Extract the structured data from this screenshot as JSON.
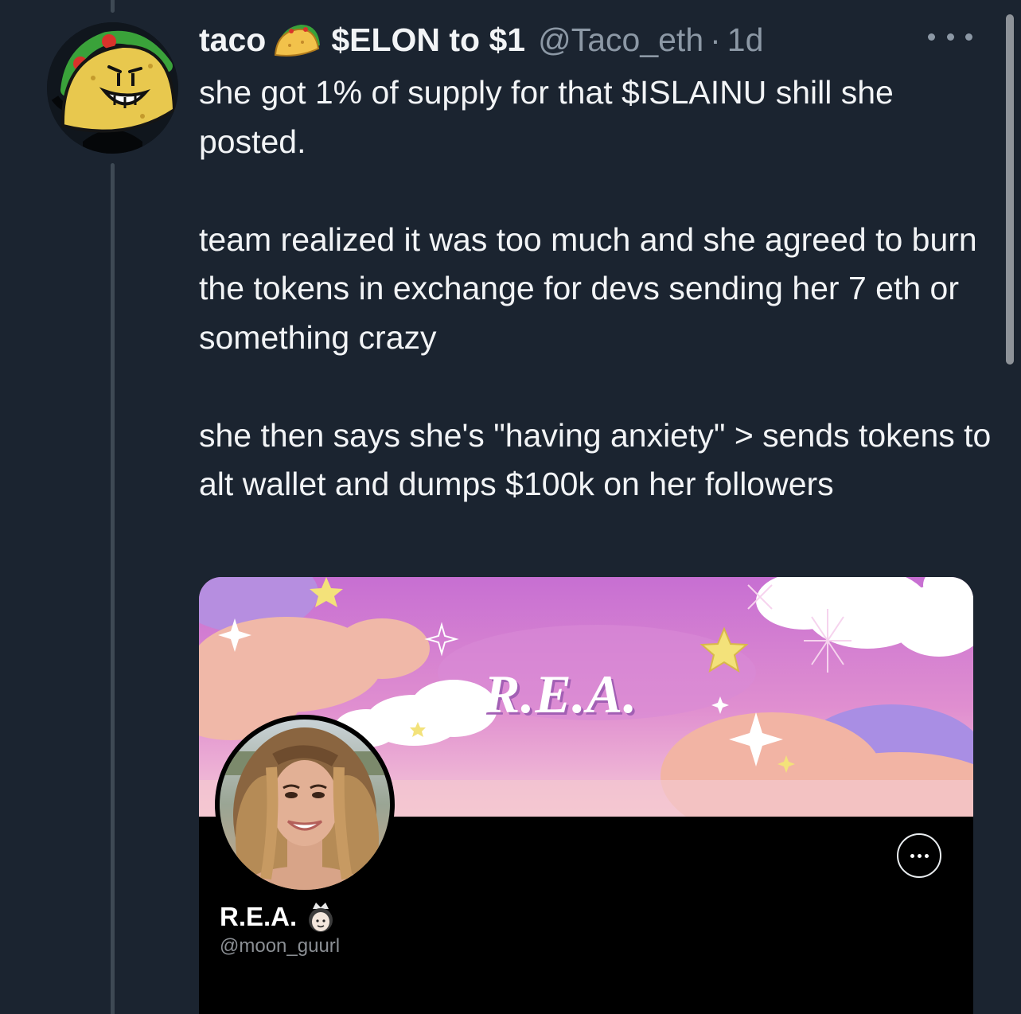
{
  "tweet": {
    "display_name": "taco",
    "name_emoji": "taco-emoji",
    "name_suffix": "$ELON to $1",
    "handle": "@Taco_eth",
    "separator": "·",
    "time": "1d",
    "paragraphs": [
      "she got 1% of supply for that $ISLAINU shill she posted.",
      "team realized it was too much and she agreed to burn the tokens in exchange for devs sending her 7 eth or something crazy",
      "she then says she's \"having anxiety\" > sends tokens to alt wallet and dumps $100k on her followers"
    ],
    "more_icon": "more-horizontal-icon"
  },
  "card": {
    "banner_title": "R.E.A.",
    "profile_name": "R.E.A.",
    "profile_emoji": "princess-emoji",
    "profile_handle": "@moon_guurl",
    "more_icon": "more-circle-icon"
  },
  "colors": {
    "background": "#1b2430",
    "text_primary": "#f2f4f6",
    "text_secondary": "#8c98a5",
    "thread_line": "#3e4954",
    "card_background": "#000000"
  }
}
